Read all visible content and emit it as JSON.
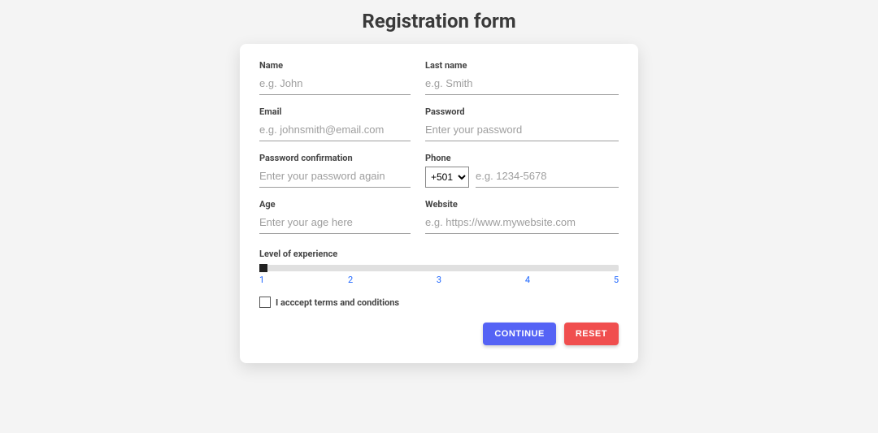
{
  "title": "Registration form",
  "fields": {
    "name": {
      "label": "Name",
      "placeholder": "e.g. John"
    },
    "lastname": {
      "label": "Last name",
      "placeholder": "e.g. Smith"
    },
    "email": {
      "label": "Email",
      "placeholder": "e.g. johnsmith@email.com"
    },
    "password": {
      "label": "Password",
      "placeholder": "Enter your password"
    },
    "password_confirm": {
      "label": "Password confirmation",
      "placeholder": "Enter your password again"
    },
    "phone": {
      "label": "Phone",
      "prefix": "+501",
      "placeholder": "e.g. 1234-5678"
    },
    "age": {
      "label": "Age",
      "placeholder": "Enter your age here"
    },
    "website": {
      "label": "Website",
      "placeholder": "e.g. https://www.mywebsite.com"
    }
  },
  "experience": {
    "label": "Level of experience",
    "ticks": [
      "1",
      "2",
      "3",
      "4",
      "5"
    ],
    "value": 1
  },
  "terms": {
    "label": "I acccept terms and conditions",
    "checked": false
  },
  "buttons": {
    "continue": "CONTINUE",
    "reset": "RESET"
  }
}
